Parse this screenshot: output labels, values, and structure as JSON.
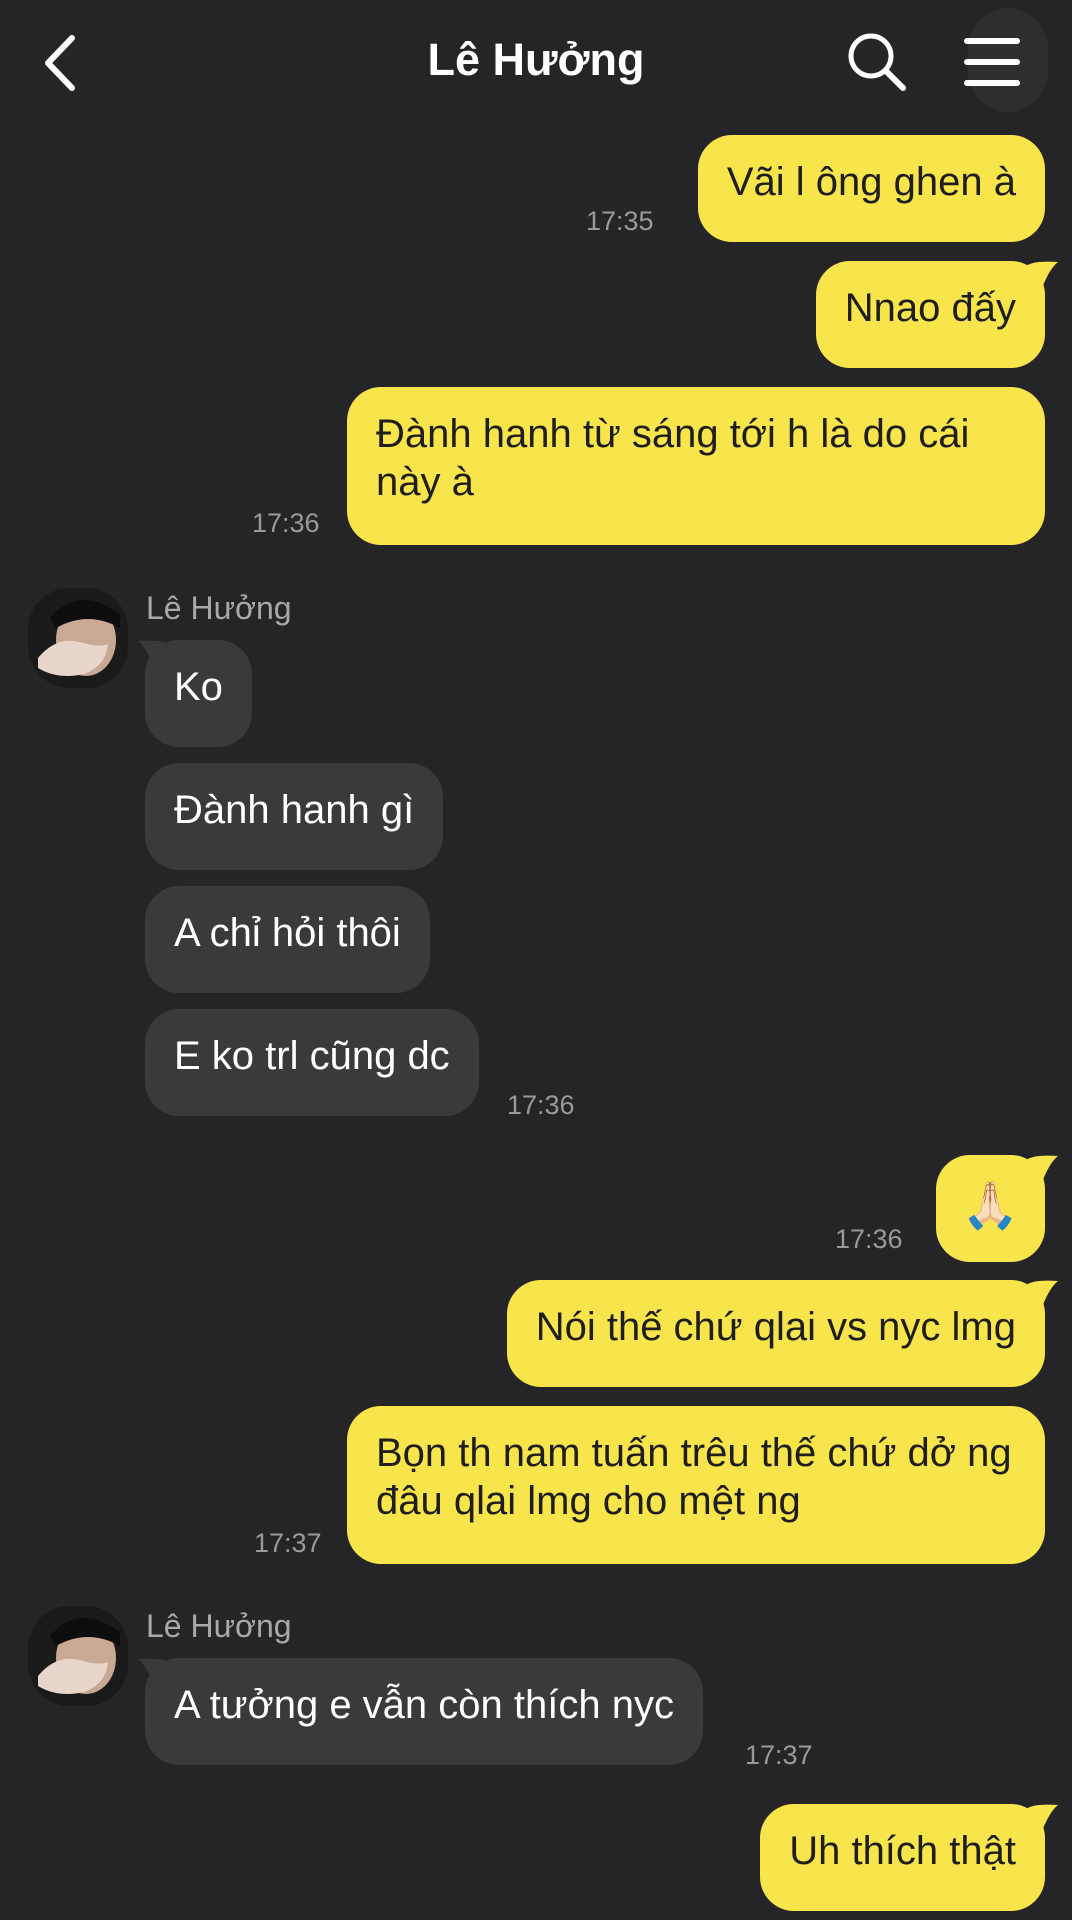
{
  "header": {
    "title": "Lê Hưởng",
    "back_icon": "chevron-left-icon",
    "search_icon": "search-icon",
    "menu_icon": "hamburger-menu-icon"
  },
  "colors": {
    "background": "#252527",
    "my_bubble": "#f8e44b",
    "their_bubble": "#3a3a3c"
  },
  "messages": [
    {
      "from": "me",
      "text": "Vãi l ông ghen à",
      "time": "17:35"
    },
    {
      "from": "me",
      "text": "Nnao đấy"
    },
    {
      "from": "me",
      "text": "Đành hanh từ sáng tới h là do cái này à",
      "time": "17:36"
    },
    {
      "from": "them",
      "sender": "Lê Hưởng",
      "text": "Ko"
    },
    {
      "from": "them",
      "text": "Đành hanh gì"
    },
    {
      "from": "them",
      "text": "A chỉ hỏi thôi"
    },
    {
      "from": "them",
      "text": "E ko trl cũng dc",
      "time": "17:36"
    },
    {
      "from": "me",
      "text": "🙏🏻",
      "time": "17:36"
    },
    {
      "from": "me",
      "text": "Nói thế chứ qlai vs nyc lmg"
    },
    {
      "from": "me",
      "text": "Bọn th nam tuấn trêu thế chứ dở ng đâu qlai lmg cho mệt ng",
      "time": "17:37"
    },
    {
      "from": "them",
      "sender": "Lê Hưởng",
      "text": "A tưởng e vẫn còn thích nyc",
      "time": "17:37"
    },
    {
      "from": "me",
      "text": "Uh thích thật"
    }
  ]
}
